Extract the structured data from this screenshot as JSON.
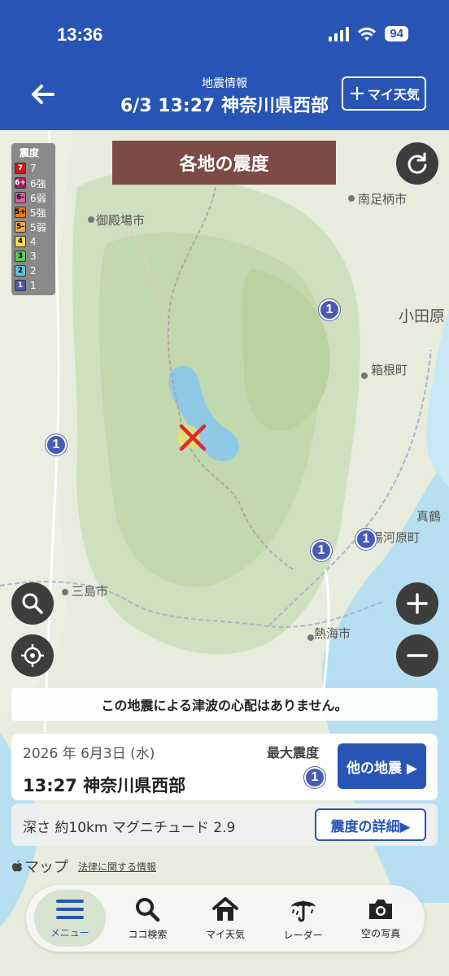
{
  "status_bar": {
    "time": "13:36",
    "battery": "94"
  },
  "header": {
    "subtitle": "地震情報",
    "title": "6/3 13:27 神奈川県西部",
    "my_weather_label": "マイ天気"
  },
  "banner": {
    "label": "各地の震度"
  },
  "legend": {
    "title": "震度",
    "items": [
      {
        "chip": "7",
        "label": "7",
        "color": "#c8191e"
      },
      {
        "chip": "6+",
        "label": "6強",
        "color": "#a51a5c"
      },
      {
        "chip": "6-",
        "label": "6弱",
        "color": "#d85fa0"
      },
      {
        "chip": "5+",
        "label": "5強",
        "color": "#e07a1f"
      },
      {
        "chip": "5-",
        "label": "5弱",
        "color": "#f0a64a"
      },
      {
        "chip": "4",
        "label": "4",
        "color": "#f2df4a"
      },
      {
        "chip": "3",
        "label": "3",
        "color": "#5cc95a"
      },
      {
        "chip": "2",
        "label": "2",
        "color": "#5fc3d6"
      },
      {
        "chip": "1",
        "label": "1",
        "color": "#4a5bb5"
      }
    ]
  },
  "map": {
    "places": {
      "gotemba": "御殿場市",
      "minami_ashigara": "南足柄市",
      "odawara": "小田原",
      "hakone": "箱根町",
      "mishima": "三島市",
      "atami": "熱海市",
      "manazuru": "真鶴",
      "yugawara": "湯河原町"
    },
    "markers": [
      "1",
      "1",
      "1",
      "1"
    ]
  },
  "tsunami_notice": "この地震による津波の心配はありません。",
  "quake_card": {
    "date": "2026 年 6月3日 (水)",
    "place": "13:27 神奈川県西部",
    "max_label": "最大震度",
    "max_value": "1",
    "other_button": "他の地震 ▶"
  },
  "detail": {
    "text": "深さ 約10km マグニチュード 2.9",
    "button": "震度の詳細▶"
  },
  "attribution": {
    "maps": "マップ",
    "legal": "法律に関する情報"
  },
  "tabs": [
    {
      "label": "メニュー",
      "icon": "menu-icon"
    },
    {
      "label": "ココ検索",
      "icon": "search-icon"
    },
    {
      "label": "マイ天気",
      "icon": "home-icon"
    },
    {
      "label": "レーダー",
      "icon": "umbrella-icon"
    },
    {
      "label": "空の写真",
      "icon": "camera-icon"
    }
  ]
}
